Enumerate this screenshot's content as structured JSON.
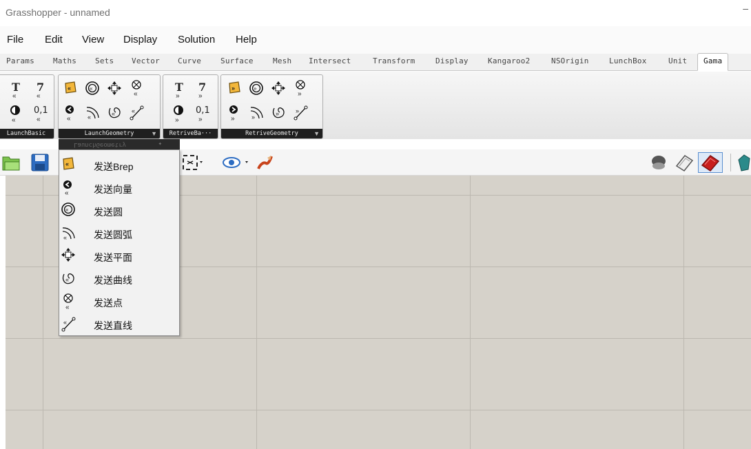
{
  "window": {
    "title": "Grasshopper - unnamed",
    "minimize_glyph": "–"
  },
  "menu": [
    "File",
    "Edit",
    "View",
    "Display",
    "Solution",
    "Help"
  ],
  "tabs": [
    "Params",
    "Maths",
    "Sets",
    "Vector",
    "Curve",
    "Surface",
    "Mesh",
    "Intersect",
    "Transform",
    "Display",
    "Kangaroo2",
    "NSOrigin",
    "LunchBox",
    "Unit",
    "Gama"
  ],
  "active_tab": "Gama",
  "panels": [
    {
      "label": "LaunchBasic",
      "text_icons": [
        "T",
        "7",
        "0,1"
      ]
    },
    {
      "label": "LaunchGeometry"
    },
    {
      "label": "RetriveBa···",
      "text_icons": [
        "T",
        "7",
        "0,1"
      ]
    },
    {
      "label": "RetriveGeometry"
    }
  ],
  "dropdown": {
    "header": "LaunchGeometry",
    "items": [
      {
        "label": "发送Brep",
        "icon": "brep-icon"
      },
      {
        "label": "发送向量",
        "icon": "vector-icon"
      },
      {
        "label": "发送圆",
        "icon": "circle-icon"
      },
      {
        "label": "发送圆弧",
        "icon": "arc-icon"
      },
      {
        "label": "发送平面",
        "icon": "plane-icon"
      },
      {
        "label": "发送曲线",
        "icon": "curve-icon"
      },
      {
        "label": "发送点",
        "icon": "point-icon"
      },
      {
        "label": "发送直线",
        "icon": "line-icon"
      }
    ]
  },
  "colors": {
    "canvas": "#d6d2ca",
    "grid": "#bcb8b0",
    "gem": "#c81e1e",
    "brep": "#f3b73b"
  }
}
